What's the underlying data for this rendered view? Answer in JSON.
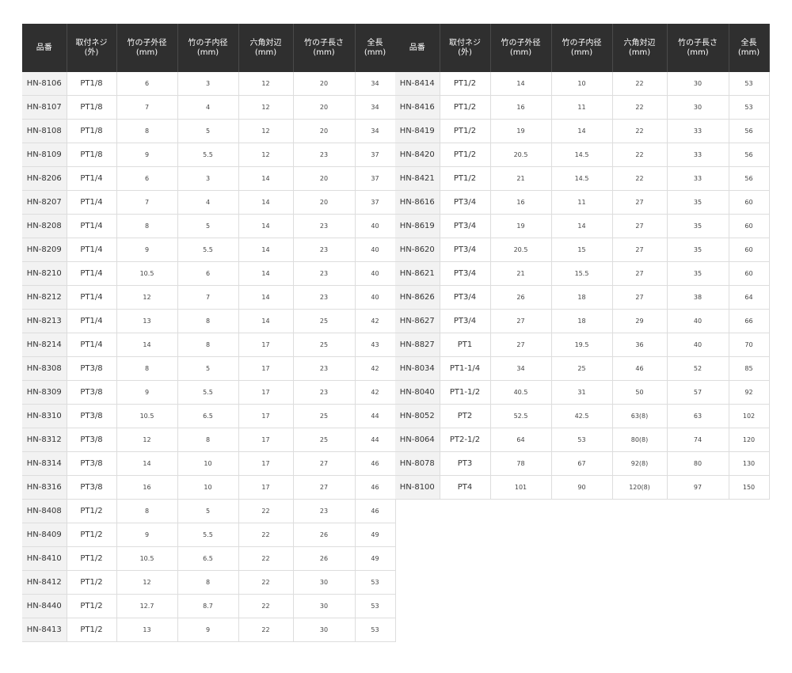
{
  "columns": [
    "品番",
    "取付ネジ\n(外)",
    "竹の子外径\n(mm)",
    "竹の子内径\n(mm)",
    "六角対辺\n(mm)",
    "竹の子長さ\n(mm)",
    "全長\n(mm)"
  ],
  "left_rows": [
    [
      "HN-8106",
      "PT1/8",
      "6",
      "3",
      "12",
      "20",
      "34"
    ],
    [
      "HN-8107",
      "PT1/8",
      "7",
      "4",
      "12",
      "20",
      "34"
    ],
    [
      "HN-8108",
      "PT1/8",
      "8",
      "5",
      "12",
      "20",
      "34"
    ],
    [
      "HN-8109",
      "PT1/8",
      "9",
      "5.5",
      "12",
      "23",
      "37"
    ],
    [
      "HN-8206",
      "PT1/4",
      "6",
      "3",
      "14",
      "20",
      "37"
    ],
    [
      "HN-8207",
      "PT1/4",
      "7",
      "4",
      "14",
      "20",
      "37"
    ],
    [
      "HN-8208",
      "PT1/4",
      "8",
      "5",
      "14",
      "23",
      "40"
    ],
    [
      "HN-8209",
      "PT1/4",
      "9",
      "5.5",
      "14",
      "23",
      "40"
    ],
    [
      "HN-8210",
      "PT1/4",
      "10.5",
      "6",
      "14",
      "23",
      "40"
    ],
    [
      "HN-8212",
      "PT1/4",
      "12",
      "7",
      "14",
      "23",
      "40"
    ],
    [
      "HN-8213",
      "PT1/4",
      "13",
      "8",
      "14",
      "25",
      "42"
    ],
    [
      "HN-8214",
      "PT1/4",
      "14",
      "8",
      "17",
      "25",
      "43"
    ],
    [
      "HN-8308",
      "PT3/8",
      "8",
      "5",
      "17",
      "23",
      "42"
    ],
    [
      "HN-8309",
      "PT3/8",
      "9",
      "5.5",
      "17",
      "23",
      "42"
    ],
    [
      "HN-8310",
      "PT3/8",
      "10.5",
      "6.5",
      "17",
      "25",
      "44"
    ],
    [
      "HN-8312",
      "PT3/8",
      "12",
      "8",
      "17",
      "25",
      "44"
    ],
    [
      "HN-8314",
      "PT3/8",
      "14",
      "10",
      "17",
      "27",
      "46"
    ],
    [
      "HN-8316",
      "PT3/8",
      "16",
      "10",
      "17",
      "27",
      "46"
    ],
    [
      "HN-8408",
      "PT1/2",
      "8",
      "5",
      "22",
      "23",
      "46"
    ],
    [
      "HN-8409",
      "PT1/2",
      "9",
      "5.5",
      "22",
      "26",
      "49"
    ],
    [
      "HN-8410",
      "PT1/2",
      "10.5",
      "6.5",
      "22",
      "26",
      "49"
    ],
    [
      "HN-8412",
      "PT1/2",
      "12",
      "8",
      "22",
      "30",
      "53"
    ],
    [
      "HN-8440",
      "PT1/2",
      "12.7",
      "8.7",
      "22",
      "30",
      "53"
    ],
    [
      "HN-8413",
      "PT1/2",
      "13",
      "9",
      "22",
      "30",
      "53"
    ]
  ],
  "right_rows": [
    [
      "HN-8414",
      "PT1/2",
      "14",
      "10",
      "22",
      "30",
      "53"
    ],
    [
      "HN-8416",
      "PT1/2",
      "16",
      "11",
      "22",
      "30",
      "53"
    ],
    [
      "HN-8419",
      "PT1/2",
      "19",
      "14",
      "22",
      "33",
      "56"
    ],
    [
      "HN-8420",
      "PT1/2",
      "20.5",
      "14.5",
      "22",
      "33",
      "56"
    ],
    [
      "HN-8421",
      "PT1/2",
      "21",
      "14.5",
      "22",
      "33",
      "56"
    ],
    [
      "HN-8616",
      "PT3/4",
      "16",
      "11",
      "27",
      "35",
      "60"
    ],
    [
      "HN-8619",
      "PT3/4",
      "19",
      "14",
      "27",
      "35",
      "60"
    ],
    [
      "HN-8620",
      "PT3/4",
      "20.5",
      "15",
      "27",
      "35",
      "60"
    ],
    [
      "HN-8621",
      "PT3/4",
      "21",
      "15.5",
      "27",
      "35",
      "60"
    ],
    [
      "HN-8626",
      "PT3/4",
      "26",
      "18",
      "27",
      "38",
      "64"
    ],
    [
      "HN-8627",
      "PT3/4",
      "27",
      "18",
      "29",
      "40",
      "66"
    ],
    [
      "HN-8827",
      "PT1",
      "27",
      "19.5",
      "36",
      "40",
      "70"
    ],
    [
      "HN-8034",
      "PT1-1/4",
      "34",
      "25",
      "46",
      "52",
      "85"
    ],
    [
      "HN-8040",
      "PT1-1/2",
      "40.5",
      "31",
      "50",
      "57",
      "92"
    ],
    [
      "HN-8052",
      "PT2",
      "52.5",
      "42.5",
      "63(8)",
      "63",
      "102"
    ],
    [
      "HN-8064",
      "PT2-1/2",
      "64",
      "53",
      "80(8)",
      "74",
      "120"
    ],
    [
      "HN-8078",
      "PT3",
      "78",
      "67",
      "92(8)",
      "80",
      "130"
    ],
    [
      "HN-8100",
      "PT4",
      "101",
      "90",
      "120(8)",
      "97",
      "150"
    ]
  ]
}
